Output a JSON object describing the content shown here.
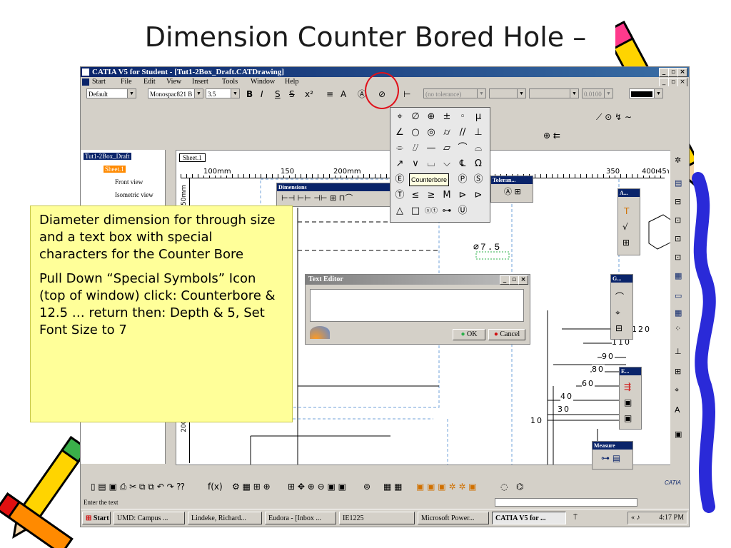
{
  "slide": {
    "title": "Dimension Counter Bored Hole –"
  },
  "window": {
    "title": "CATIA V5 for Student - [Tut1-2Box_Draft.CATDrawing]"
  },
  "menu": [
    "Start",
    "File",
    "Edit",
    "View",
    "Insert",
    "Tools",
    "Window",
    "Help"
  ],
  "toolbar": {
    "style_value": "Default",
    "font_value": "Monospac821 B",
    "font_size_value": "3.5",
    "tolerance_value": "(no tolerance)",
    "precision_value": "0.0100"
  },
  "tree": {
    "root": "Tut1-2Box_Draft",
    "items": [
      "Sheet.1",
      "Front view",
      "Isometric view"
    ]
  },
  "drawing": {
    "sheet_tab": "Sheet.1",
    "ruler_top": [
      "100mm",
      "150",
      "200mm",
      "350",
      "400mm",
      "45"
    ],
    "ruler_left": [
      "250mm",
      "200mm"
    ],
    "diameter_label": "∅7.5",
    "dims": [
      "120",
      "110",
      "90",
      "80",
      "60",
      "40",
      "30",
      "10"
    ]
  },
  "panels": {
    "dimensions": "Dimensions",
    "tolerance": "Toleran...",
    "a_panel": "A...",
    "g_panel": "G...",
    "e_panel": "E...",
    "measure": "Measure"
  },
  "symbol_palette": {
    "tooltip": "Counterbore",
    "rows": [
      [
        "⌖",
        "∅",
        "⊕",
        "±",
        "◦",
        "μ"
      ],
      [
        "∠",
        "○",
        "◎",
        "⌭",
        "//",
        "⊥"
      ],
      [
        "⌯",
        "⌰",
        "—",
        "▱",
        "⌒",
        "⌓"
      ],
      [
        "↗",
        "∨",
        "⌴",
        "⌵",
        "℄",
        "Ω"
      ],
      [
        "Ⓔ",
        "",
        "",
        "",
        "Ⓟ",
        "Ⓢ"
      ],
      [
        "Ⓣ",
        "≤",
        "≥",
        "M",
        "⊳",
        "⊳"
      ],
      [
        "△",
        "□",
        "ⓢⓣ",
        "⊶",
        "Ⓤ",
        ""
      ]
    ]
  },
  "text_editor": {
    "title": "Text Editor",
    "ok": "OK",
    "cancel": "Cancel"
  },
  "callout": {
    "p1": "Diameter dimension for through size and a text box with special characters for the Counter Bore",
    "p2": "Pull Down “Special Symbols” Icon (top of window) click: Counterbore & 12.5 … return then: Depth & 5, Set Font Size to 7"
  },
  "status": {
    "text": "Enter the text"
  },
  "taskbar": {
    "start": "Start",
    "tasks": [
      "UMD: Campus ...",
      "Lindeke, Richard...",
      "Eudora - [Inbox ...",
      "IE1225",
      "Microsoft Power...",
      "CATIA V5 for ..."
    ],
    "time": "4:17 PM"
  },
  "colors": {
    "title_bar": "#0a246a",
    "callout_bg": "#ffff99",
    "highlight_circle": "#e0101a"
  }
}
